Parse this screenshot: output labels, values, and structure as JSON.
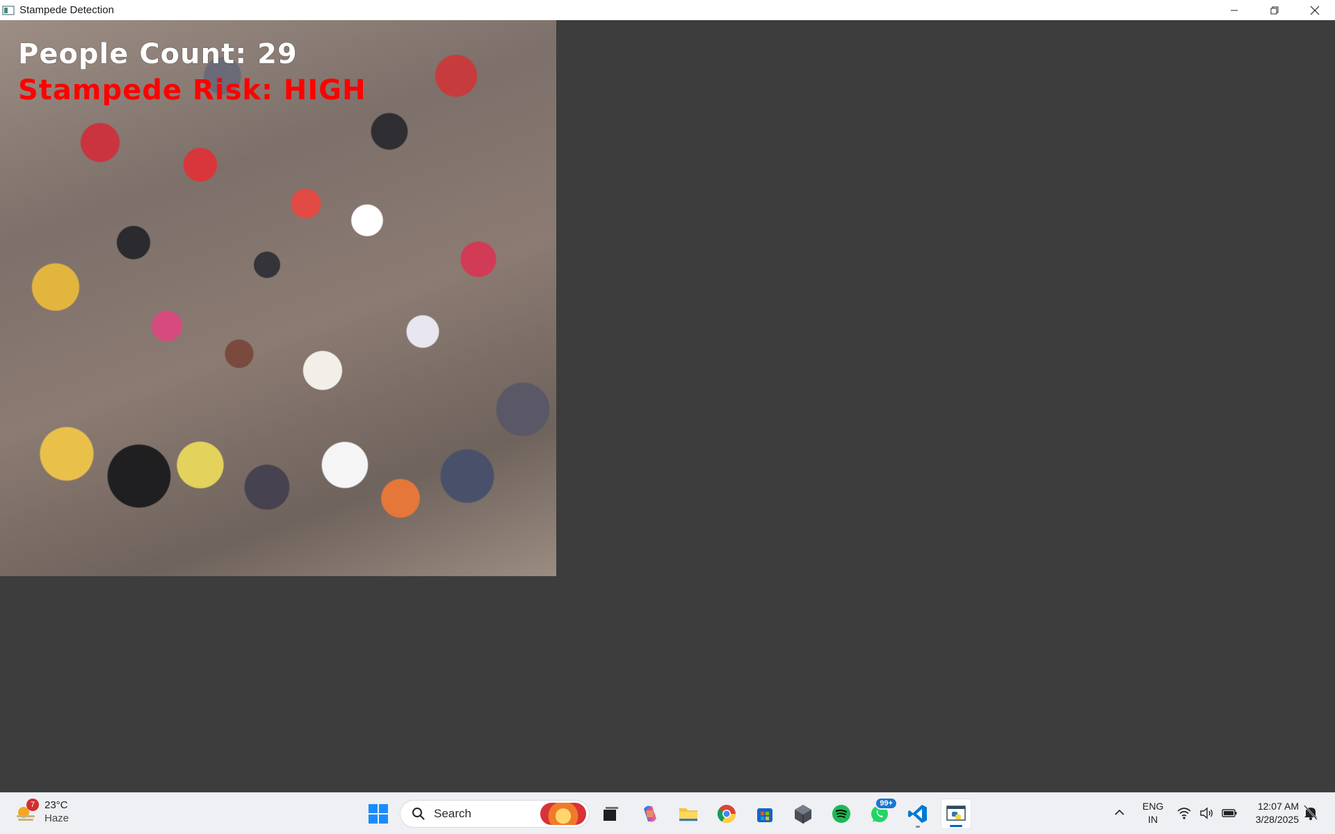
{
  "window": {
    "title": "Stampede Detection",
    "controls": [
      "minimize-icon",
      "restore-icon",
      "close-icon"
    ]
  },
  "video": {
    "people_count_text": "People Count: 29",
    "risk_text": "Stampede Risk: HIGH",
    "risk_color": "#ff0000",
    "count_color": "#ffffff"
  },
  "taskbar": {
    "weather": {
      "temp": "23°C",
      "condition": "Haze",
      "alert_count": "7"
    },
    "search": {
      "placeholder": "Search"
    },
    "apps": [
      {
        "name": "start-icon"
      },
      {
        "name": "task-view-icon"
      },
      {
        "name": "copilot-icon"
      },
      {
        "name": "file-explorer-icon"
      },
      {
        "name": "chrome-icon"
      },
      {
        "name": "store-icon"
      },
      {
        "name": "app-cube-icon"
      },
      {
        "name": "spotify-icon"
      },
      {
        "name": "whatsapp-icon",
        "badge": "99+"
      },
      {
        "name": "vscode-icon"
      },
      {
        "name": "python-window-icon"
      }
    ],
    "tray": {
      "language_top": "ENG",
      "language_bottom": "IN",
      "time": "12:07 AM",
      "date": "3/28/2025"
    },
    "accent": "#0067c0"
  }
}
